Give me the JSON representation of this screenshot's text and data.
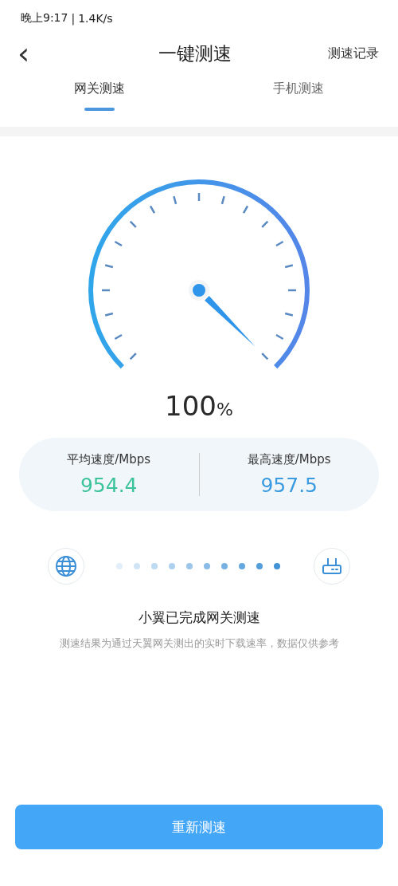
{
  "status_bar": {
    "time": "晚上9:17",
    "separator": "|",
    "speed": "1.4K/s"
  },
  "header": {
    "back": "‹",
    "title": "一键测速",
    "action": "测速记录"
  },
  "tabs": [
    {
      "label": "网关测速",
      "selected": true
    },
    {
      "label": "手机测速",
      "selected": false
    }
  ],
  "gauge": {
    "value": "100",
    "unit": "%"
  },
  "stats": [
    {
      "label": "平均速度/Mbps",
      "value": "954.4",
      "color": "#3cc39a"
    },
    {
      "label": "最高速度/Mbps",
      "value": "957.5",
      "color": "#3a9be0"
    }
  ],
  "result": {
    "title": "小翼已完成网关测速",
    "note": "测速结果为通过天翼网关测出的实时下载速率，数据仅供参考"
  },
  "button": "重新测速"
}
